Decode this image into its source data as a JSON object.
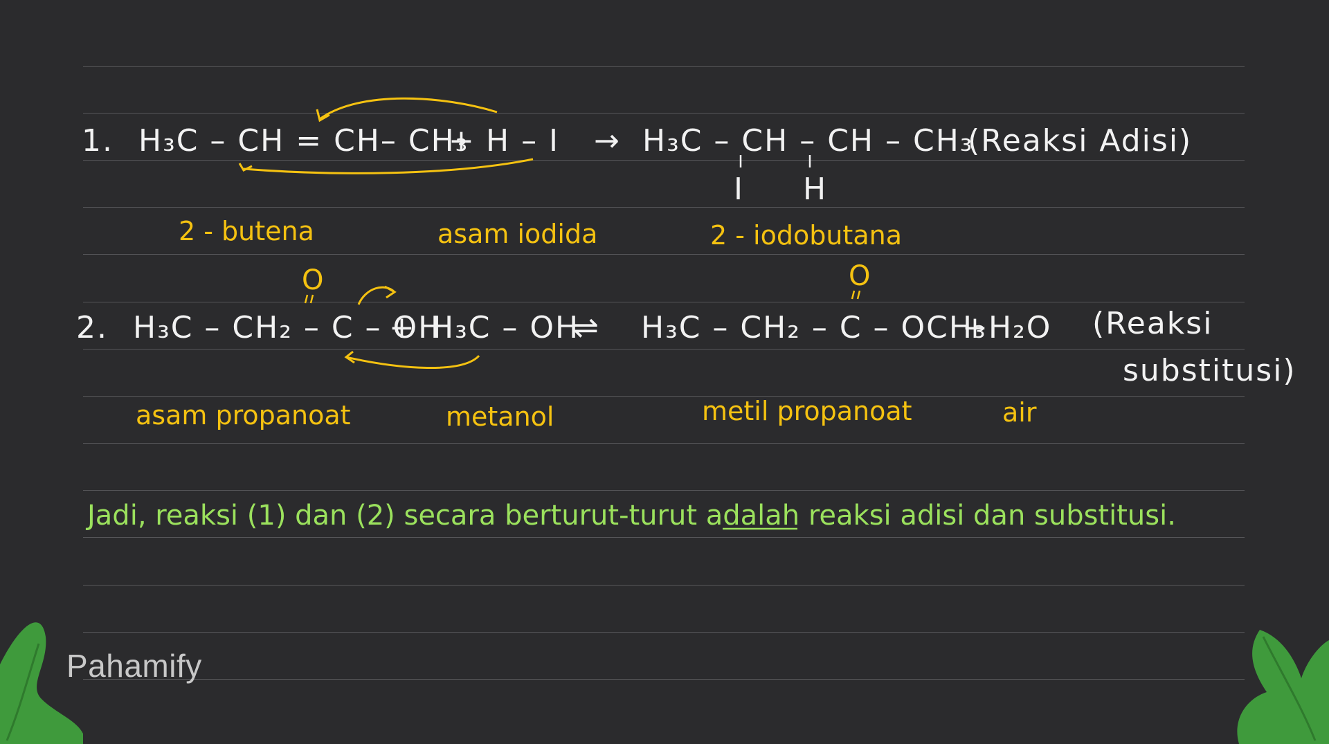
{
  "reaction1": {
    "number": "1.",
    "reactant1": "H₃C – CH = CH– CH₃",
    "plus": "+",
    "reactant2": "H – I",
    "arrow": "→",
    "product_chain": "H₃C – CH – CH – CH₃",
    "sub_I": "I",
    "sub_H": "H",
    "type": "(Reaksi Adisi)",
    "name_reactant1": "2 - butena",
    "name_reactant2": "asam iodida",
    "name_product": "2 - iodobutana"
  },
  "reaction2": {
    "number": "2.",
    "reactant1": "H₃C – CH₂ – C – OH",
    "plus1": "+",
    "reactant2": "H₃C – OH",
    "arrow": "⇌",
    "product1": "H₃C – CH₂ – C – OCH₃",
    "plus2": "+",
    "product2": "H₂O",
    "oxygen1": "O",
    "oxygen2": "O",
    "type_line1": "(Reaksi",
    "type_line2": "substitusi)",
    "name_reactant1": "asam propanoat",
    "name_reactant2": "metanol",
    "name_product1": "metil propanoat",
    "name_product2": "air"
  },
  "conclusion": "Jadi, reaksi (1) dan (2) secara berturut-turut adalah reaksi adisi dan substitusi.",
  "brand": "Pahamify",
  "colors": {
    "background": "#2b2b2d",
    "formula": "#f2f2f2",
    "annotation": "#f5c211",
    "conclusion": "#9be15d",
    "leaf": "#3f9a3c"
  }
}
